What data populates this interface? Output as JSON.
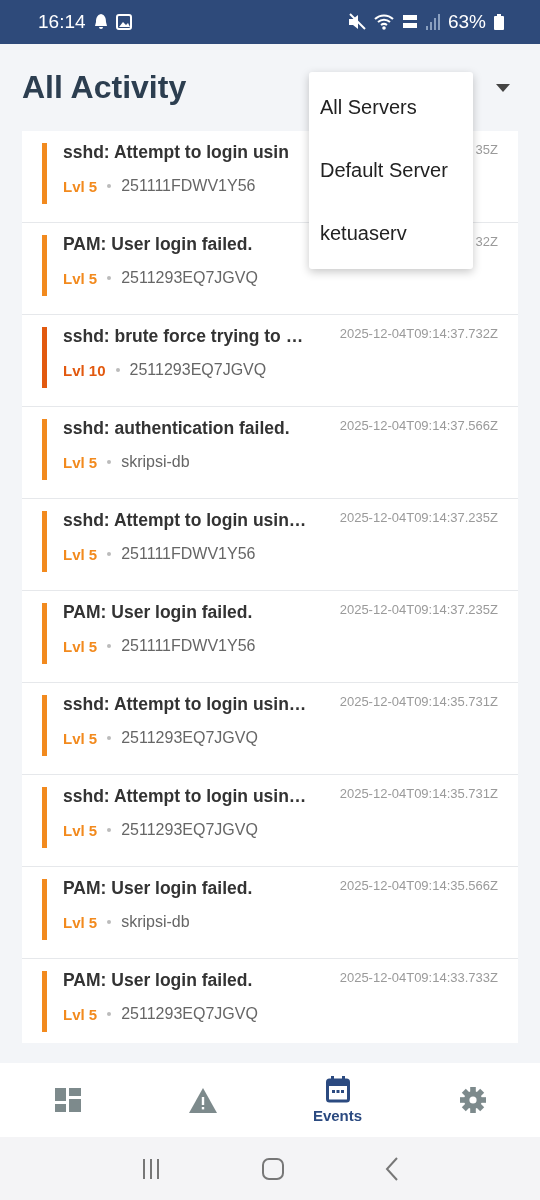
{
  "status_bar": {
    "time": "16:14",
    "battery": "63%"
  },
  "header": {
    "title": "All Activity"
  },
  "server_menu": {
    "items": [
      {
        "label": "All Servers"
      },
      {
        "label": "Default Server"
      },
      {
        "label": "ketuaserv"
      }
    ]
  },
  "events": [
    {
      "title": "sshd: Attempt to login usin",
      "timestamp": "35Z",
      "level": "Lvl 5",
      "host": "251111FDWV1Y56",
      "color": "#f28a1e"
    },
    {
      "title": "PAM: User login failed.",
      "timestamp": "32Z",
      "level": "Lvl 5",
      "host": "2511293EQ7JGVQ",
      "color": "#f28a1e"
    },
    {
      "title": "sshd: brute force trying to …",
      "timestamp": "2025-12-04T09:14:37.732Z",
      "level": "Lvl 10",
      "host": "2511293EQ7JGVQ",
      "color": "#e2590f"
    },
    {
      "title": "sshd: authentication failed.",
      "timestamp": "2025-12-04T09:14:37.566Z",
      "level": "Lvl 5",
      "host": "skripsi-db",
      "color": "#f28a1e"
    },
    {
      "title": "sshd: Attempt to login usin…",
      "timestamp": "2025-12-04T09:14:37.235Z",
      "level": "Lvl 5",
      "host": "251111FDWV1Y56",
      "color": "#f28a1e"
    },
    {
      "title": "PAM: User login failed.",
      "timestamp": "2025-12-04T09:14:37.235Z",
      "level": "Lvl 5",
      "host": "251111FDWV1Y56",
      "color": "#f28a1e"
    },
    {
      "title": "sshd: Attempt to login usin…",
      "timestamp": "2025-12-04T09:14:35.731Z",
      "level": "Lvl 5",
      "host": "2511293EQ7JGVQ",
      "color": "#f28a1e"
    },
    {
      "title": "sshd: Attempt to login usin…",
      "timestamp": "2025-12-04T09:14:35.731Z",
      "level": "Lvl 5",
      "host": "2511293EQ7JGVQ",
      "color": "#f28a1e"
    },
    {
      "title": "PAM: User login failed.",
      "timestamp": "2025-12-04T09:14:35.566Z",
      "level": "Lvl 5",
      "host": "skripsi-db",
      "color": "#f28a1e"
    },
    {
      "title": "PAM: User login failed.",
      "timestamp": "2025-12-04T09:14:33.733Z",
      "level": "Lvl 5",
      "host": "2511293EQ7JGVQ",
      "color": "#f28a1e"
    }
  ],
  "bottom_nav": [
    {
      "kind": "dashboard",
      "selected": false
    },
    {
      "kind": "alerts",
      "selected": false
    },
    {
      "kind": "events",
      "label": "Events",
      "selected": true
    },
    {
      "kind": "settings",
      "selected": false
    }
  ]
}
